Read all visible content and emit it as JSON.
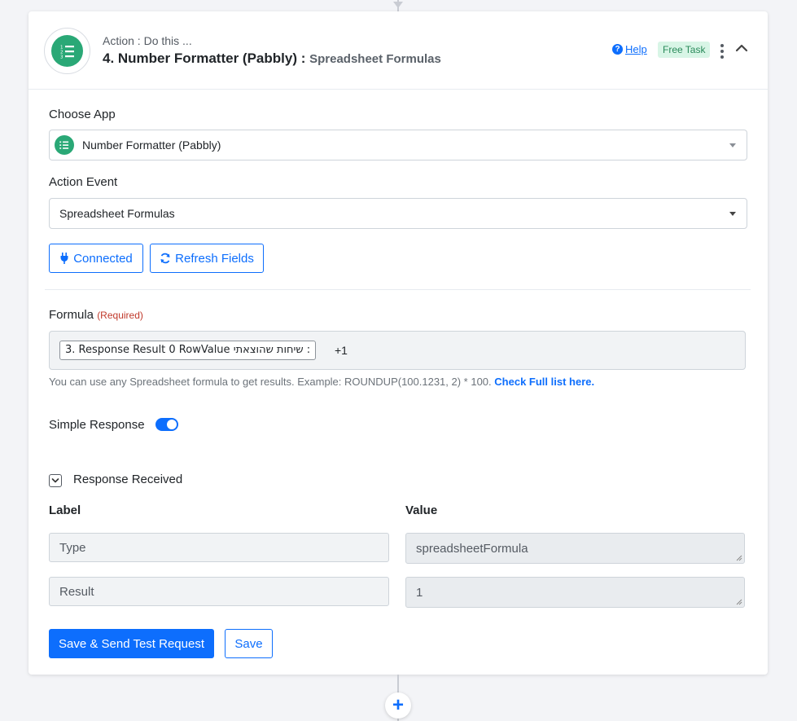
{
  "step": {
    "kicker": "Action : Do this ...",
    "title": "4. Number Formatter (Pabbly) :",
    "subtitle": "Spreadsheet Formulas",
    "help_label": "Help",
    "badge": "Free Task"
  },
  "choose_app": {
    "label": "Choose App",
    "value": "Number Formatter (Pabbly)"
  },
  "action_event": {
    "label": "Action Event",
    "value": "Spreadsheet Formulas"
  },
  "buttons": {
    "connected": "Connected",
    "refresh": "Refresh Fields",
    "save_send": "Save & Send Test Request",
    "save": "Save"
  },
  "formula": {
    "label": "Formula",
    "required": "(Required)",
    "chip": "3. Response Result 0 RowValue שיחות שהוצאתי :",
    "suffix": "+1",
    "hint": "You can use any Spreadsheet formula to get results. Example: ROUNDUP(100.1231, 2) * 100.",
    "hint_link": "Check Full list here."
  },
  "simple_response": {
    "label": "Simple Response",
    "enabled": true
  },
  "response": {
    "title": "Response Received",
    "label_header": "Label",
    "value_header": "Value",
    "rows": [
      {
        "label": "Type",
        "value": "spreadsheetFormula"
      },
      {
        "label": "Result",
        "value": "1"
      }
    ]
  },
  "colors": {
    "primary": "#0d6efd",
    "app_green": "#2aa876",
    "badge_bg": "#d8f5e6",
    "required_red": "#c0392b"
  }
}
